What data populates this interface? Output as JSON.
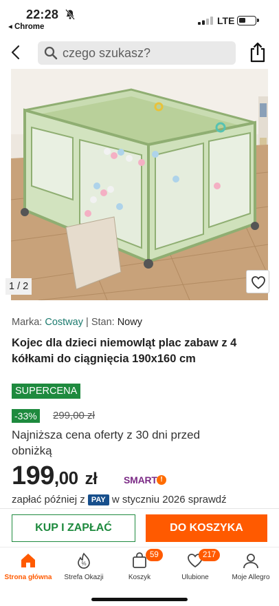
{
  "status_bar": {
    "time": "22:28",
    "back_app": "◂ Chrome",
    "network": "LTE"
  },
  "search": {
    "placeholder": "czego szukasz?"
  },
  "gallery": {
    "pager": "1 / 2"
  },
  "product": {
    "brand_label": "Marka:",
    "brand": "Costway",
    "separator": "|",
    "condition_label": "Stan:",
    "condition": "Nowy",
    "title": "Kojec dla dzieci niemowląt plac zabaw z 4 kółkami do ciągnięcia 190x160 cm",
    "badge": "SUPERCENA",
    "discount": "-33%",
    "old_price": "299,00 zł",
    "lowest_price_note": "Najniższa cena oferty z 30 dni przed obniżką",
    "price_main": "199",
    "price_cents": ",00",
    "price_currency": "zł",
    "smart_label": "SMART",
    "pay_later_prefix": "zapłać później z",
    "pay_badge": "PAY",
    "pay_later_suffix": "w styczniu 2026 sprawdź"
  },
  "actions": {
    "buy_now": "KUP I ZAPŁAĆ",
    "add_to_cart": "DO KOSZYKA"
  },
  "tabbar": {
    "items": [
      {
        "label": "Strona główna",
        "icon": "home-icon",
        "active": true
      },
      {
        "label": "Strefa Okazji",
        "icon": "deals-icon"
      },
      {
        "label": "Koszyk",
        "icon": "cart-icon",
        "count": "59"
      },
      {
        "label": "Ulubione",
        "icon": "heart-icon",
        "count": "217"
      },
      {
        "label": "Moje Allegro",
        "icon": "user-icon"
      }
    ]
  },
  "colors": {
    "accent_orange": "#ff5a00",
    "brand_green": "#1e8a3e",
    "link_teal": "#1b7a6e"
  }
}
